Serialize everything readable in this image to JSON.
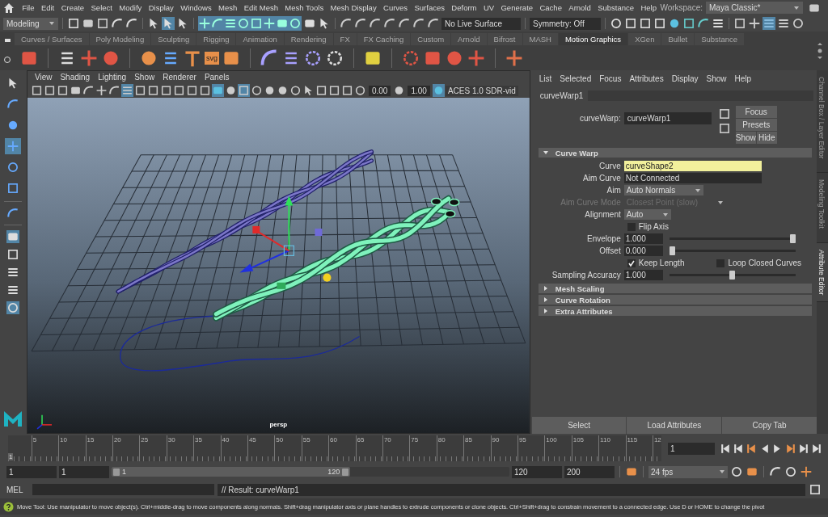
{
  "menu_bar": {
    "items": [
      "File",
      "Edit",
      "Create",
      "Select",
      "Modify",
      "Display",
      "Windows",
      "Mesh",
      "Edit Mesh",
      "Mesh Tools",
      "Mesh Display",
      "Curves",
      "Surfaces",
      "Deform",
      "UV",
      "Generate",
      "Cache",
      "Arnold",
      "Substance",
      "Help"
    ],
    "workspace_label": "Workspace:",
    "workspace": "Maya Classic*"
  },
  "status_line": {
    "mode": "Modeling",
    "live_surface": "No Live Surface",
    "symmetry": "Symmetry: Off"
  },
  "shelf": {
    "tabs": [
      {
        "label": "Curves / Surfaces",
        "selected": false
      },
      {
        "label": "Poly Modeling",
        "selected": false
      },
      {
        "label": "Sculpting",
        "selected": false
      },
      {
        "label": "Rigging",
        "selected": false
      },
      {
        "label": "Animation",
        "selected": false
      },
      {
        "label": "Rendering",
        "selected": false
      },
      {
        "label": "FX",
        "selected": false
      },
      {
        "label": "FX Caching",
        "selected": false
      },
      {
        "label": "Custom",
        "selected": false
      },
      {
        "label": "Arnold",
        "selected": false
      },
      {
        "label": "Bifrost",
        "selected": false
      },
      {
        "label": "MASH",
        "selected": false
      },
      {
        "label": "Motion Graphics",
        "selected": true
      },
      {
        "label": "XGen",
        "selected": false
      },
      {
        "label": "Bullet",
        "selected": false
      },
      {
        "label": "Substance",
        "selected": false
      }
    ],
    "svg_icon_label": "svg"
  },
  "viewport": {
    "menus": [
      "View",
      "Shading",
      "Lighting",
      "Show",
      "Renderer",
      "Panels"
    ],
    "exposure": "0.00",
    "gamma": "1.00",
    "color_space": "ACES 1.0 SDR-vid",
    "camera": "persp"
  },
  "attribute_editor": {
    "menus": [
      "List",
      "Selected",
      "Focus",
      "Attributes",
      "Display",
      "Show",
      "Help"
    ],
    "tab": "curveWarp1",
    "node_label": "curveWarp:",
    "node_name": "curveWarp1",
    "buttons": [
      "Focus",
      "Presets",
      "Show",
      "Hide"
    ],
    "sections": [
      {
        "title": "Curve Warp",
        "expanded": true,
        "rows": [
          {
            "kind": "field",
            "label": "Curve",
            "value": "curveShape2",
            "highlighted": true
          },
          {
            "kind": "field",
            "label": "Aim Curve",
            "value": "Not Connected",
            "highlighted": false
          },
          {
            "kind": "dropdown",
            "label": "Aim",
            "value": "Auto Normals",
            "disabled": false
          },
          {
            "kind": "dropdown",
            "label": "Aim Curve Mode",
            "value": "Closest Point (slow)",
            "disabled": true
          },
          {
            "kind": "dropdown",
            "label": "Alignment",
            "value": "Auto",
            "disabled": false
          },
          {
            "kind": "checkbox",
            "label": "Flip Axis",
            "checked": false
          },
          {
            "kind": "slider",
            "label": "Envelope",
            "value": "1.000",
            "level": 1.0
          },
          {
            "kind": "slider",
            "label": "Offset",
            "value": "0.000",
            "level": 0.0
          },
          {
            "kind": "checkbox_pair",
            "items": [
              {
                "label": "Keep Length",
                "checked": true
              },
              {
                "label": "Loop Closed Curves",
                "checked": false
              }
            ]
          },
          {
            "kind": "slider",
            "label": "Sampling Accuracy",
            "value": "1.000",
            "level": 0.5
          }
        ]
      },
      {
        "title": "Mesh Scaling",
        "expanded": false
      },
      {
        "title": "Curve Rotation",
        "expanded": false
      },
      {
        "title": "Extra Attributes",
        "expanded": false
      }
    ],
    "footer_buttons": [
      "Select",
      "Load Attributes",
      "Copy Tab"
    ]
  },
  "side_tabs": [
    {
      "label": "Channel Box / Layer Editor",
      "selected": false
    },
    {
      "label": "Modeling Toolkit",
      "selected": false
    },
    {
      "label": "Attribute Editor",
      "selected": true
    }
  ],
  "timeline": {
    "ticks": [
      "5",
      "10",
      "15",
      "20",
      "25",
      "30",
      "35",
      "40",
      "45",
      "50",
      "55",
      "60",
      "65",
      "70",
      "75",
      "80",
      "85",
      "90",
      "95",
      "100",
      "105",
      "110",
      "115",
      "12"
    ],
    "current": "1",
    "level": 0.0,
    "frame_field": "1"
  },
  "range": {
    "start": "1",
    "playback_start": "1",
    "slider_start": "1",
    "slider_end": "120",
    "playback_end": "120",
    "end": "200",
    "fps": "24 fps"
  },
  "command_line": {
    "language": "MEL",
    "result": "// Result: curveWarp1"
  },
  "help_line": {
    "text": "Move Tool: Use manipulator to move object(s). Ctrl+middle-drag to move components along normals. Shift+drag manipulator axis or plane handles to extrude components or clone objects. Ctrl+Shift+drag to constrain movement to a connected edge. Use D or HOME to change the pivot"
  }
}
